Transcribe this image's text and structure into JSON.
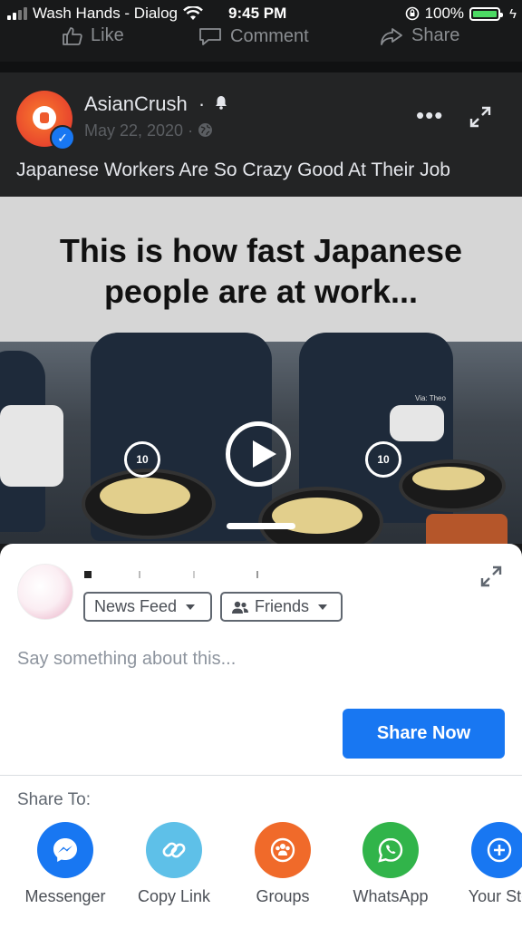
{
  "status_bar": {
    "carrier": "Wash Hands - Dialog",
    "time": "9:45 PM",
    "battery_percent": "100%",
    "battery_level": 1.0,
    "colors": {
      "battery": "#4cd964"
    }
  },
  "post_actions": {
    "like": "Like",
    "comment": "Comment",
    "share": "Share"
  },
  "post": {
    "page_name": "AsianCrush",
    "dot": "·",
    "date": "May 22, 2020",
    "date_separator": "·",
    "caption": "Japanese Workers Are So Crazy Good At Their Job",
    "more_icon": "more-horizontal-icon",
    "expand_icon": "expand-icon"
  },
  "video": {
    "banner_line1": "This is how fast Japanese",
    "banner_line2": "people are at work...",
    "watermark": "Via: Theo",
    "rewind_label": "10",
    "forward_label": "10"
  },
  "share_sheet": {
    "audience_feed": "News Feed",
    "audience_privacy": "Friends",
    "placeholder": "Say something about this...",
    "share_now": "Share Now",
    "share_to_label": "Share To:",
    "targets": [
      {
        "label": "Messenger",
        "icon": "messenger-icon",
        "color": "#1877f2"
      },
      {
        "label": "Copy Link",
        "icon": "link-icon",
        "color": "#5ec0e8"
      },
      {
        "label": "Groups",
        "icon": "groups-icon",
        "color": "#f06a2a"
      },
      {
        "label": "WhatsApp",
        "icon": "whatsapp-icon",
        "color": "#31b44a"
      },
      {
        "label": "Your Sto",
        "icon": "add-story-icon",
        "color": "#1877f2"
      }
    ]
  },
  "colors": {
    "accent": "#1877f2",
    "dark_bg": "#18191a"
  }
}
